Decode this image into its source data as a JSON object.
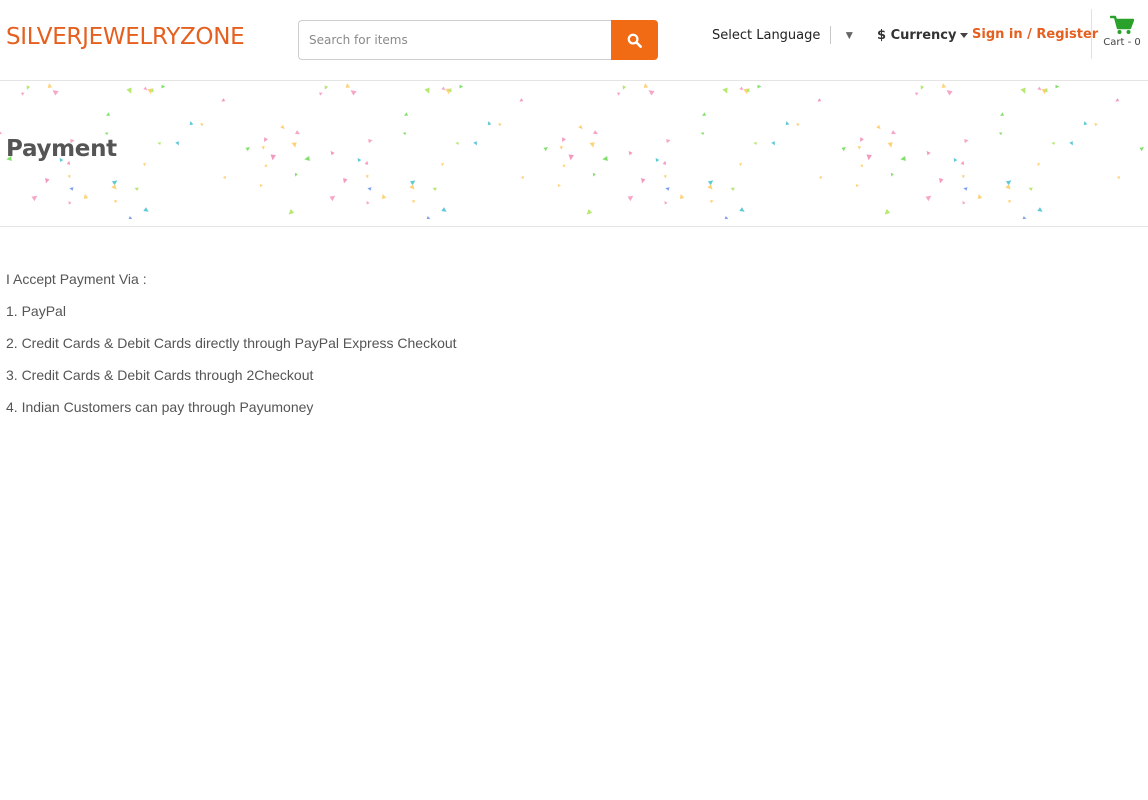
{
  "header": {
    "logo": "SILVERJEWELRYZONE",
    "search": {
      "placeholder": "Search for items",
      "value": ""
    },
    "language": {
      "label": "Select Language",
      "arrow": "▼"
    },
    "currency": {
      "label": "$ Currency"
    },
    "signin": "Sign in / Register",
    "cart": {
      "label": "Cart - 0"
    }
  },
  "banner": {
    "title": "Payment"
  },
  "content": {
    "intro": "I Accept Payment Via :",
    "items": [
      "1. PayPal",
      "2. Credit Cards & Debit Cards directly through PayPal Express Checkout",
      "3. Credit Cards & Debit Cards through 2Checkout",
      "4. Indian Customers can pay through Payumoney"
    ]
  },
  "colors": {
    "brand_orange": "#e55f1f",
    "search_button": "#f16a14",
    "cart_green": "#2aa12a",
    "text_gray": "#555555"
  },
  "icons": {
    "search_button": "search-icon",
    "cart": "shopping-cart-icon"
  }
}
